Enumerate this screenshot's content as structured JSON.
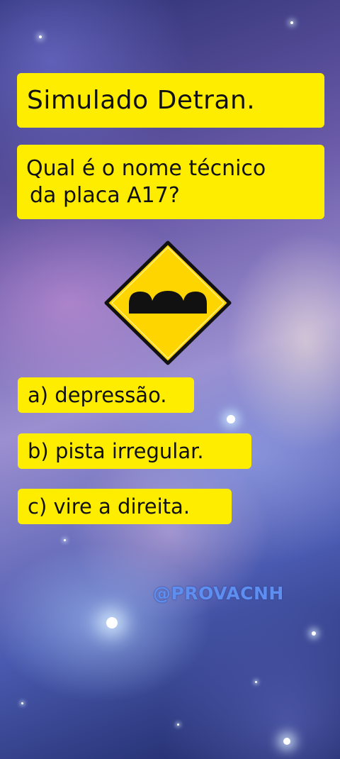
{
  "title": "Simulado Detran.",
  "question": {
    "line1": "Qual é o nome técnico",
    "line2": "da placa A17?"
  },
  "sign": {
    "icon": "road-bumps-warning-sign-icon",
    "fill_color": "#ffd500",
    "border_color": "#111111"
  },
  "options": [
    {
      "text": "a) depressão."
    },
    {
      "text": "b) pista irregular."
    },
    {
      "text": "c) vire a direita."
    }
  ],
  "watermark": "@PROVACNH",
  "colors": {
    "card": "#ffed00",
    "text": "#111111",
    "watermark": "#5d8ef0"
  }
}
